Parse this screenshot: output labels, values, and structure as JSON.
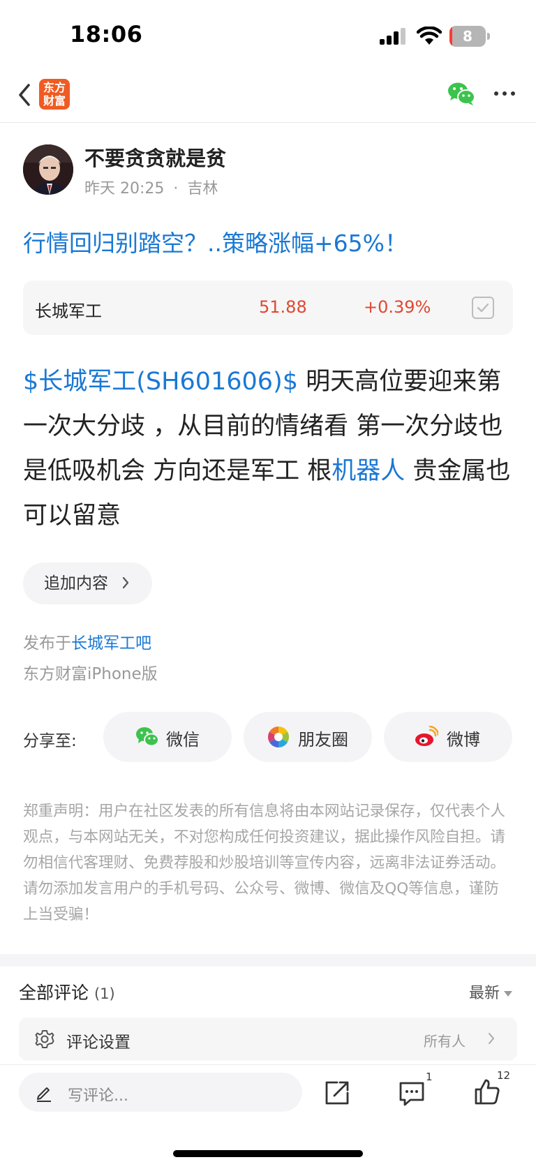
{
  "status_bar": {
    "time": "18:06",
    "battery": "8",
    "battery_level": 0.08
  },
  "nav": {
    "logo_line1": "东方",
    "logo_line2": "财富"
  },
  "author": {
    "name": "不要贪贪就是贫",
    "time": "昨天 20:25",
    "location": "吉林",
    "separator": "·"
  },
  "post": {
    "title": "行情回归别踏空？..策略涨幅+65%！",
    "stock_card": {
      "name": "长城军工",
      "price": "51.88",
      "change": "+0.39%"
    },
    "body": {
      "stock_tag": "$长城军工(SH601606)$",
      "text1": " 明天高位要迎来第一次大分歧 ，从目前的情绪看 第一次分歧也是低吸机会 方向还是军工 根",
      "topic_link": "机器人",
      "text2": " 贵金属也可以留意"
    },
    "add_content_label": "追加内容",
    "published_prefix": "发布于",
    "forum_link": "长城军工吧",
    "client": "东方财富iPhone版"
  },
  "share": {
    "label": "分享至:",
    "wechat": "微信",
    "moments": "朋友圈",
    "weibo": "微博"
  },
  "disclaimer": "郑重声明：用户在社区发表的所有信息将由本网站记录保存，仅代表个人观点，与本网站无关，不对您构成任何投资建议，据此操作风险自担。请勿相信代客理财、免费荐股和炒股培训等宣传内容，远离非法证券活动。请勿添加发言用户的手机号码、公众号、微博、微信及QQ等信息，谨防上当受骗！",
  "comments": {
    "title": "全部评论",
    "count": "(1)",
    "sort": "最新",
    "settings_label": "评论设置",
    "settings_value": "所有人"
  },
  "bottom_bar": {
    "input_placeholder": "写评论...",
    "comment_badge": "1",
    "like_badge": "12"
  },
  "colors": {
    "link_blue": "#1a78d4",
    "stock_red": "#e0482f",
    "logo_orange": "#ef5b22",
    "wechat_green": "#3cc34d"
  }
}
